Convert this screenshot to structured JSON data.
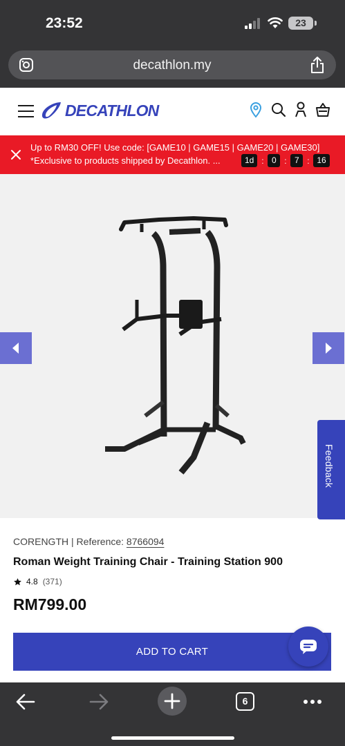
{
  "status_bar": {
    "time": "23:52",
    "battery": "23"
  },
  "browser": {
    "url": "decathlon.my",
    "tabs_count": "6"
  },
  "brand": {
    "logo_text": "DECATHLON",
    "accent": "#3643ba"
  },
  "promo": {
    "line1": "Up to RM30 OFF! Use code: [GAME10 | GAME15 | GAME20 | GAME30]",
    "line2": "*Exclusive to products shipped by Decathlon. ...",
    "countdown": {
      "days": "1d",
      "hours": "0",
      "minutes": "7",
      "seconds": "16"
    },
    "color": "#e91a26"
  },
  "product": {
    "brand": "CORENGTH",
    "reference_label": "Reference:",
    "reference": "8766094",
    "title": "Roman Weight Training Chair - Training Station 900",
    "rating": "4.8",
    "rating_count": "(371)",
    "price": "RM799.00",
    "add_to_cart": "ADD TO CART"
  },
  "feedback_label": "Feedback",
  "icons": [
    "site-settings-icon",
    "share-icon",
    "menu-icon",
    "location-icon",
    "search-icon",
    "account-icon",
    "basket-icon",
    "close-icon",
    "chevron-left-icon",
    "chevron-right-icon",
    "chat-icon",
    "back-icon",
    "forward-icon",
    "new-tab-icon",
    "more-icon"
  ]
}
